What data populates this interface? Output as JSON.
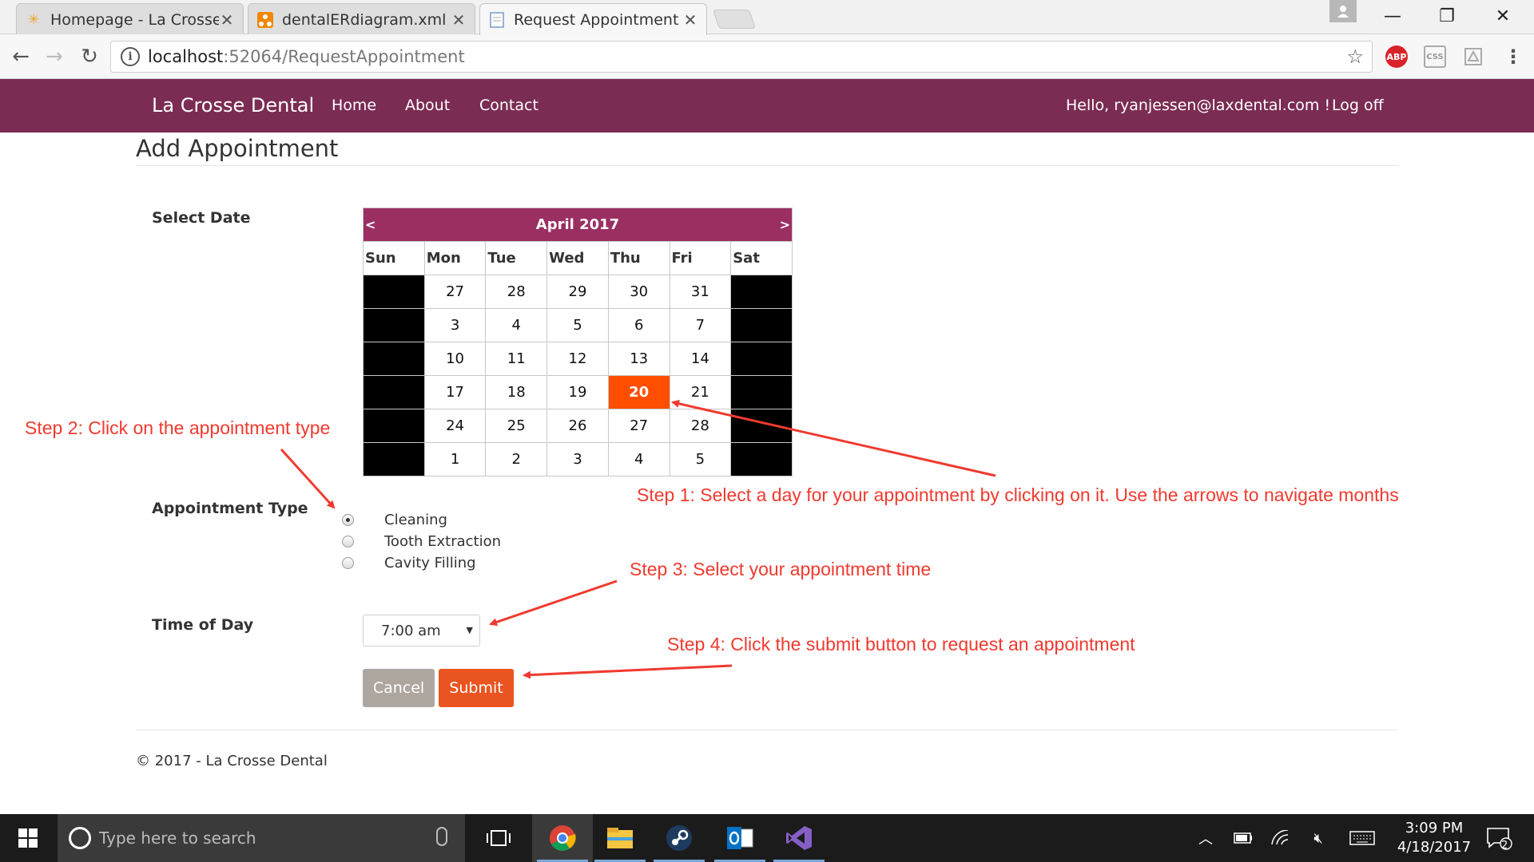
{
  "browser": {
    "tabs": [
      {
        "title": "Homepage - La Crosse",
        "icon": "sun-favicon"
      },
      {
        "title": "dentalERdiagram.xml - d",
        "icon": "diagram-favicon"
      },
      {
        "title": "Request Appointment - L",
        "icon": "page-favicon",
        "active": true
      }
    ],
    "url_host": "localhost",
    "url_path": ":52064/RequestAppointment",
    "abp_label": "ABP"
  },
  "nav": {
    "brand": "La Crosse Dental",
    "links": [
      "Home",
      "About",
      "Contact"
    ],
    "greeting": "Hello, ryanjessen@laxdental.com !",
    "logoff": "Log off",
    "bg_color": "#7b2c53"
  },
  "page": {
    "title": "Add Appointment",
    "select_date_label": "Select Date",
    "appointment_type_label": "Appointment Type",
    "time_of_day_label": "Time of Day",
    "appointment_types": [
      {
        "label": "Cleaning",
        "checked": true
      },
      {
        "label": "Tooth Extraction",
        "checked": false
      },
      {
        "label": "Cavity Filling",
        "checked": false
      }
    ],
    "time_selected": "7:00 am",
    "cancel_label": "Cancel",
    "submit_label": "Submit",
    "footer": "© 2017 - La Crosse Dental"
  },
  "calendar": {
    "month_label": "April 2017",
    "prev": "<",
    "next": ">",
    "weekdays": [
      "Sun",
      "Mon",
      "Tue",
      "Wed",
      "Thu",
      "Fri",
      "Sat"
    ],
    "weeks": [
      [
        "",
        "27",
        "28",
        "29",
        "30",
        "31",
        ""
      ],
      [
        "",
        "3",
        "4",
        "5",
        "6",
        "7",
        ""
      ],
      [
        "",
        "10",
        "11",
        "12",
        "13",
        "14",
        ""
      ],
      [
        "",
        "17",
        "18",
        "19",
        "20",
        "21",
        ""
      ],
      [
        "",
        "24",
        "25",
        "26",
        "27",
        "28",
        ""
      ],
      [
        "",
        "1",
        "2",
        "3",
        "4",
        "5",
        ""
      ]
    ],
    "selected_day": "20",
    "header_color": "#9b2f62",
    "selected_color": "#ff4e00"
  },
  "annotations": {
    "step1": "Step 1: Select a day for your appointment by clicking on it.  Use the arrows to navigate months",
    "step2": "Step 2: Click on the appointment type",
    "step3": "Step 3: Select your appointment time",
    "step4": "Step 4: Click the submit button to request an appointment",
    "color": "#f03a2f"
  },
  "taskbar": {
    "search_placeholder": "Type here to search",
    "time": "3:09 PM",
    "date": "4/18/2017",
    "notification_count": "2",
    "apps": [
      "chrome-icon",
      "file-explorer-icon",
      "steam-icon",
      "outlook-icon",
      "visual-studio-icon"
    ]
  }
}
